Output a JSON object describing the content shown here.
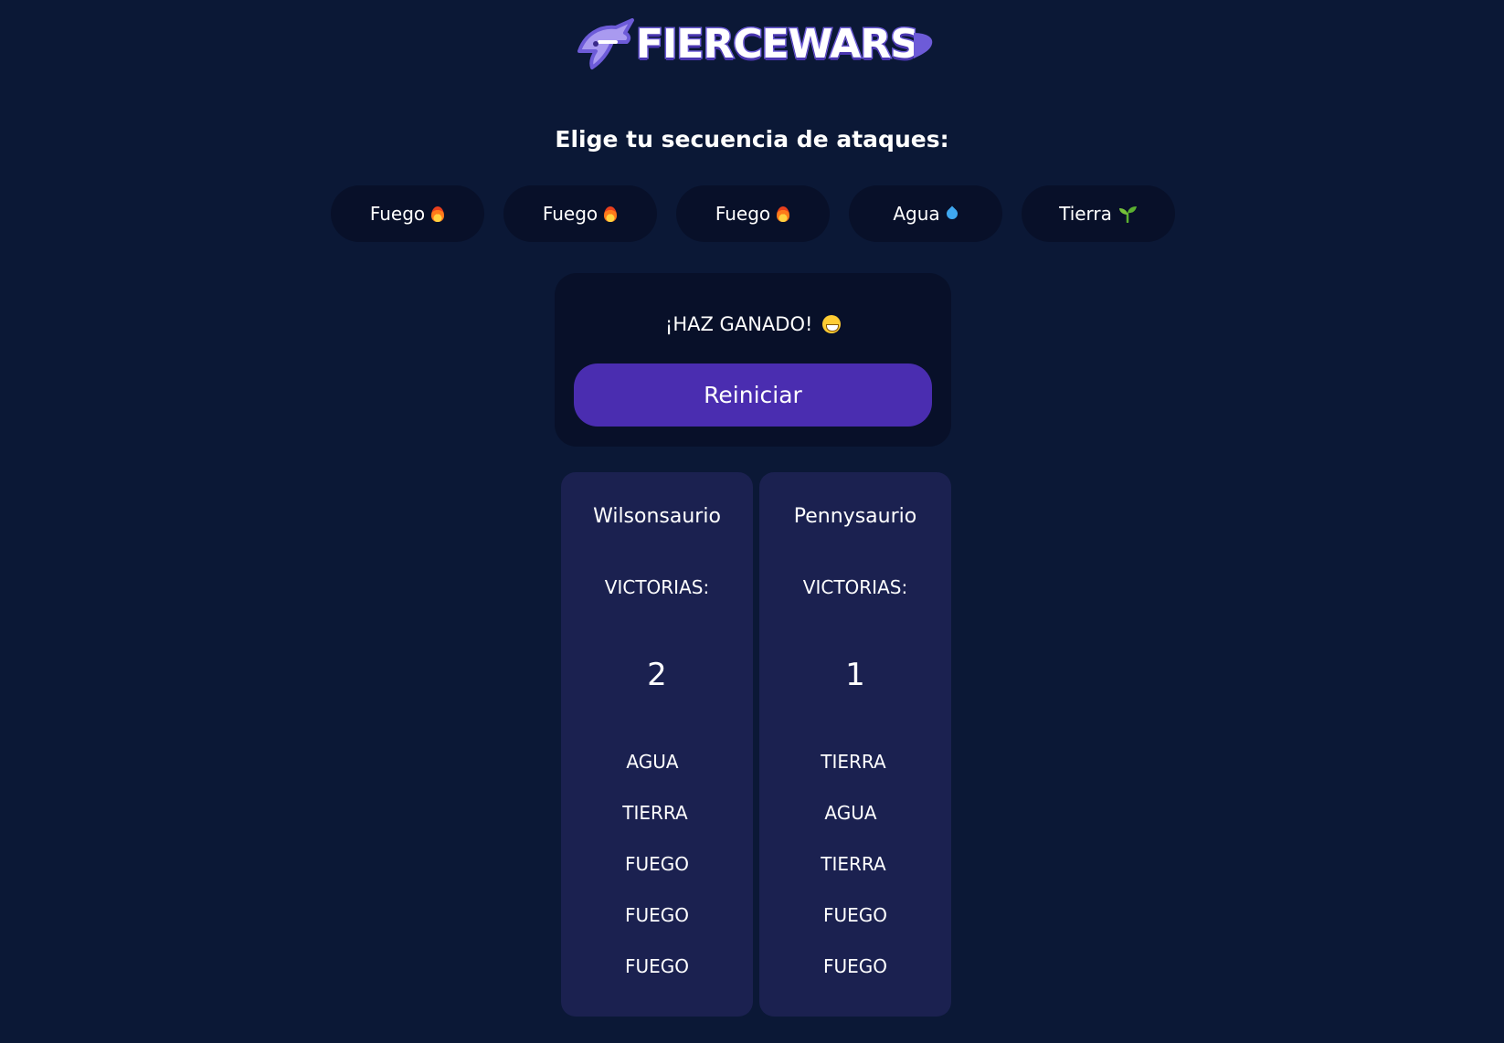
{
  "header": {
    "logo_text": "FIERCEWARS",
    "subtitle": "Elige tu secuencia de ataques:"
  },
  "attacks": [
    {
      "label": "Fuego",
      "icon": "fire-icon"
    },
    {
      "label": "Fuego",
      "icon": "fire-icon"
    },
    {
      "label": "Fuego",
      "icon": "fire-icon"
    },
    {
      "label": "Agua",
      "icon": "water-drop-icon"
    },
    {
      "label": "Tierra",
      "icon": "seedling-icon"
    }
  ],
  "result": {
    "message": "¡HAZ GANADO!",
    "emoji": "grinning-face-icon",
    "restart_label": "Reiniciar"
  },
  "players": [
    {
      "name": "Wilsonsaurio",
      "wins_label": "VICTORIAS:",
      "wins": "2",
      "moves": [
        "AGUA",
        "TIERRA",
        "FUEGO",
        "FUEGO",
        "FUEGO"
      ]
    },
    {
      "name": "Pennysaurio",
      "wins_label": "VICTORIAS:",
      "wins": "1",
      "moves": [
        "TIERRA",
        "AGUA",
        "TIERRA",
        "FUEGO",
        "FUEGO"
      ]
    }
  ],
  "colors": {
    "background": "#0b1836",
    "panel": "#081029",
    "card": "#1b2150",
    "accent": "#4a2db0",
    "logo_outline": "#6d5bd8"
  }
}
